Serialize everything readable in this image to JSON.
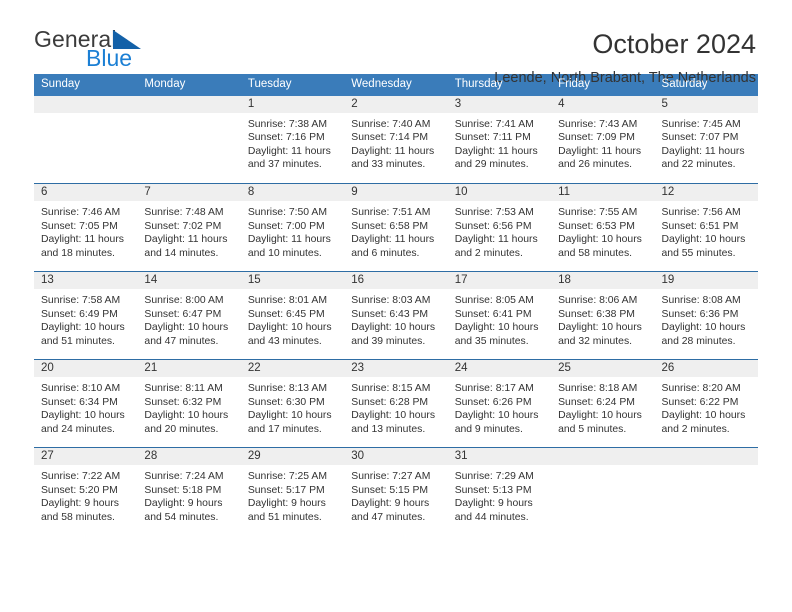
{
  "brand": {
    "name_part1": "General",
    "name_part2": "Blue",
    "triangle_color": "#1461a8",
    "blue_color": "#1b7fd4"
  },
  "header": {
    "title": "October 2024",
    "subtitle": "Leende, North Brabant, The Netherlands"
  },
  "theme": {
    "header_bg": "#3a7cba",
    "row_divider": "#2e6da4",
    "daynum_bg": "#efefef",
    "text": "#333333"
  },
  "weekday_headers": [
    "Sunday",
    "Monday",
    "Tuesday",
    "Wednesday",
    "Thursday",
    "Friday",
    "Saturday"
  ],
  "weeks": [
    [
      {
        "day": "",
        "empty": true
      },
      {
        "day": "",
        "empty": true
      },
      {
        "day": "1",
        "sunrise": "Sunrise: 7:38 AM",
        "sunset": "Sunset: 7:16 PM",
        "daylight1": "Daylight: 11 hours",
        "daylight2": "and 37 minutes."
      },
      {
        "day": "2",
        "sunrise": "Sunrise: 7:40 AM",
        "sunset": "Sunset: 7:14 PM",
        "daylight1": "Daylight: 11 hours",
        "daylight2": "and 33 minutes."
      },
      {
        "day": "3",
        "sunrise": "Sunrise: 7:41 AM",
        "sunset": "Sunset: 7:11 PM",
        "daylight1": "Daylight: 11 hours",
        "daylight2": "and 29 minutes."
      },
      {
        "day": "4",
        "sunrise": "Sunrise: 7:43 AM",
        "sunset": "Sunset: 7:09 PM",
        "daylight1": "Daylight: 11 hours",
        "daylight2": "and 26 minutes."
      },
      {
        "day": "5",
        "sunrise": "Sunrise: 7:45 AM",
        "sunset": "Sunset: 7:07 PM",
        "daylight1": "Daylight: 11 hours",
        "daylight2": "and 22 minutes."
      }
    ],
    [
      {
        "day": "6",
        "sunrise": "Sunrise: 7:46 AM",
        "sunset": "Sunset: 7:05 PM",
        "daylight1": "Daylight: 11 hours",
        "daylight2": "and 18 minutes."
      },
      {
        "day": "7",
        "sunrise": "Sunrise: 7:48 AM",
        "sunset": "Sunset: 7:02 PM",
        "daylight1": "Daylight: 11 hours",
        "daylight2": "and 14 minutes."
      },
      {
        "day": "8",
        "sunrise": "Sunrise: 7:50 AM",
        "sunset": "Sunset: 7:00 PM",
        "daylight1": "Daylight: 11 hours",
        "daylight2": "and 10 minutes."
      },
      {
        "day": "9",
        "sunrise": "Sunrise: 7:51 AM",
        "sunset": "Sunset: 6:58 PM",
        "daylight1": "Daylight: 11 hours",
        "daylight2": "and 6 minutes."
      },
      {
        "day": "10",
        "sunrise": "Sunrise: 7:53 AM",
        "sunset": "Sunset: 6:56 PM",
        "daylight1": "Daylight: 11 hours",
        "daylight2": "and 2 minutes."
      },
      {
        "day": "11",
        "sunrise": "Sunrise: 7:55 AM",
        "sunset": "Sunset: 6:53 PM",
        "daylight1": "Daylight: 10 hours",
        "daylight2": "and 58 minutes."
      },
      {
        "day": "12",
        "sunrise": "Sunrise: 7:56 AM",
        "sunset": "Sunset: 6:51 PM",
        "daylight1": "Daylight: 10 hours",
        "daylight2": "and 55 minutes."
      }
    ],
    [
      {
        "day": "13",
        "sunrise": "Sunrise: 7:58 AM",
        "sunset": "Sunset: 6:49 PM",
        "daylight1": "Daylight: 10 hours",
        "daylight2": "and 51 minutes."
      },
      {
        "day": "14",
        "sunrise": "Sunrise: 8:00 AM",
        "sunset": "Sunset: 6:47 PM",
        "daylight1": "Daylight: 10 hours",
        "daylight2": "and 47 minutes."
      },
      {
        "day": "15",
        "sunrise": "Sunrise: 8:01 AM",
        "sunset": "Sunset: 6:45 PM",
        "daylight1": "Daylight: 10 hours",
        "daylight2": "and 43 minutes."
      },
      {
        "day": "16",
        "sunrise": "Sunrise: 8:03 AM",
        "sunset": "Sunset: 6:43 PM",
        "daylight1": "Daylight: 10 hours",
        "daylight2": "and 39 minutes."
      },
      {
        "day": "17",
        "sunrise": "Sunrise: 8:05 AM",
        "sunset": "Sunset: 6:41 PM",
        "daylight1": "Daylight: 10 hours",
        "daylight2": "and 35 minutes."
      },
      {
        "day": "18",
        "sunrise": "Sunrise: 8:06 AM",
        "sunset": "Sunset: 6:38 PM",
        "daylight1": "Daylight: 10 hours",
        "daylight2": "and 32 minutes."
      },
      {
        "day": "19",
        "sunrise": "Sunrise: 8:08 AM",
        "sunset": "Sunset: 6:36 PM",
        "daylight1": "Daylight: 10 hours",
        "daylight2": "and 28 minutes."
      }
    ],
    [
      {
        "day": "20",
        "sunrise": "Sunrise: 8:10 AM",
        "sunset": "Sunset: 6:34 PM",
        "daylight1": "Daylight: 10 hours",
        "daylight2": "and 24 minutes."
      },
      {
        "day": "21",
        "sunrise": "Sunrise: 8:11 AM",
        "sunset": "Sunset: 6:32 PM",
        "daylight1": "Daylight: 10 hours",
        "daylight2": "and 20 minutes."
      },
      {
        "day": "22",
        "sunrise": "Sunrise: 8:13 AM",
        "sunset": "Sunset: 6:30 PM",
        "daylight1": "Daylight: 10 hours",
        "daylight2": "and 17 minutes."
      },
      {
        "day": "23",
        "sunrise": "Sunrise: 8:15 AM",
        "sunset": "Sunset: 6:28 PM",
        "daylight1": "Daylight: 10 hours",
        "daylight2": "and 13 minutes."
      },
      {
        "day": "24",
        "sunrise": "Sunrise: 8:17 AM",
        "sunset": "Sunset: 6:26 PM",
        "daylight1": "Daylight: 10 hours",
        "daylight2": "and 9 minutes."
      },
      {
        "day": "25",
        "sunrise": "Sunrise: 8:18 AM",
        "sunset": "Sunset: 6:24 PM",
        "daylight1": "Daylight: 10 hours",
        "daylight2": "and 5 minutes."
      },
      {
        "day": "26",
        "sunrise": "Sunrise: 8:20 AM",
        "sunset": "Sunset: 6:22 PM",
        "daylight1": "Daylight: 10 hours",
        "daylight2": "and 2 minutes."
      }
    ],
    [
      {
        "day": "27",
        "sunrise": "Sunrise: 7:22 AM",
        "sunset": "Sunset: 5:20 PM",
        "daylight1": "Daylight: 9 hours",
        "daylight2": "and 58 minutes."
      },
      {
        "day": "28",
        "sunrise": "Sunrise: 7:24 AM",
        "sunset": "Sunset: 5:18 PM",
        "daylight1": "Daylight: 9 hours",
        "daylight2": "and 54 minutes."
      },
      {
        "day": "29",
        "sunrise": "Sunrise: 7:25 AM",
        "sunset": "Sunset: 5:17 PM",
        "daylight1": "Daylight: 9 hours",
        "daylight2": "and 51 minutes."
      },
      {
        "day": "30",
        "sunrise": "Sunrise: 7:27 AM",
        "sunset": "Sunset: 5:15 PM",
        "daylight1": "Daylight: 9 hours",
        "daylight2": "and 47 minutes."
      },
      {
        "day": "31",
        "sunrise": "Sunrise: 7:29 AM",
        "sunset": "Sunset: 5:13 PM",
        "daylight1": "Daylight: 9 hours",
        "daylight2": "and 44 minutes."
      },
      {
        "day": "",
        "empty": true
      },
      {
        "day": "",
        "empty": true
      }
    ]
  ]
}
